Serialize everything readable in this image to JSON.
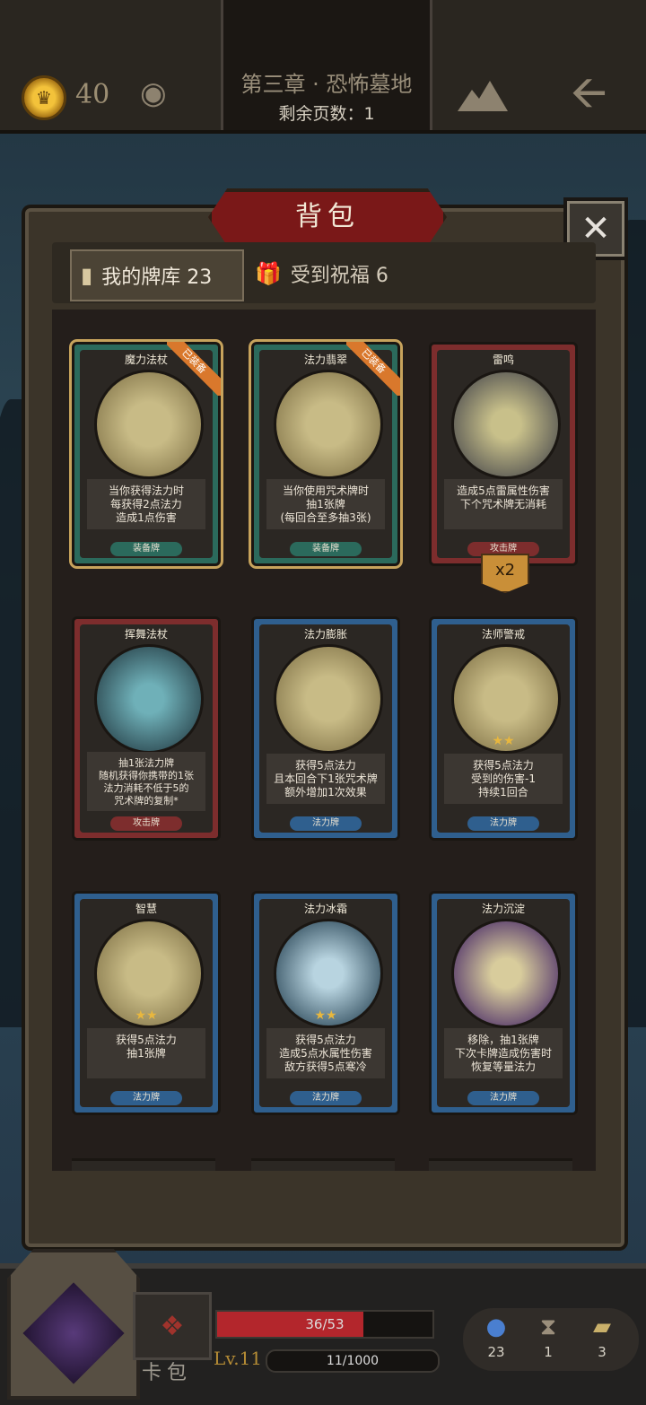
{
  "topbar": {
    "coins": "40",
    "chapter_title": "第三章 · 恐怖墓地",
    "pages_remaining": "剩余页数：1"
  },
  "panel": {
    "title": "背包",
    "close_label": "✕",
    "tabs": [
      {
        "label": "我的牌库 23",
        "icon": "card-icon"
      },
      {
        "label": "受到祝福 6",
        "icon": "gift-icon"
      }
    ]
  },
  "cards": [
    {
      "name": "魔力法杖",
      "desc": "当你获得法力时\n每获得2点法力\n造成1点伤害",
      "type": "装备牌",
      "equipped": true,
      "badge": "已装备",
      "color": "teal"
    },
    {
      "name": "法力翡翠",
      "desc": "当你使用咒术牌时\n抽1张牌\n(每回合至多抽3张)",
      "type": "装备牌",
      "equipped": true,
      "badge": "已装备",
      "color": "teal"
    },
    {
      "name": "雷鸣",
      "desc": "造成5点雷属性伤害\n下个咒术牌无消耗",
      "type": "攻击牌",
      "equipped": false,
      "count": "x2",
      "color": "red"
    },
    {
      "name": "挥舞法杖",
      "desc": "抽1张法力牌\n随机获得你携带的1张\n法力消耗不低于5的\n咒术牌的复制*",
      "type": "攻击牌",
      "equipped": false,
      "color": "red"
    },
    {
      "name": "法力膨胀",
      "desc": "获得5点法力\n且本回合下1张咒术牌\n额外增加1次效果",
      "type": "法力牌",
      "equipped": false,
      "color": "blue"
    },
    {
      "name": "法师警戒",
      "desc": "获得5点法力\n受到的伤害-1\n持续1回合",
      "type": "法力牌",
      "equipped": false,
      "stars": "★★",
      "color": "blue"
    },
    {
      "name": "智慧",
      "desc": "获得5点法力\n抽1张牌",
      "type": "法力牌",
      "equipped": false,
      "stars": "★★",
      "color": "blue"
    },
    {
      "name": "法力冰霜",
      "desc": "获得5点法力\n造成5点水属性伤害\n敌方获得5点寒冷",
      "type": "法力牌",
      "equipped": false,
      "stars": "★★",
      "color": "blue"
    },
    {
      "name": "法力沉淀",
      "desc": "移除，抽1张牌\n下次卡牌造成伤害时\n恢复等量法力",
      "type": "法力牌",
      "equipped": false,
      "color": "blue"
    }
  ],
  "hud": {
    "bag_label": "卡包",
    "hp_text": "36/53",
    "hp_fraction": 0.68,
    "level": "Lv.11",
    "xp_text": "11/1000",
    "stats": [
      {
        "icon": "potion-icon",
        "value": "23"
      },
      {
        "icon": "hourglass-icon",
        "value": "1"
      },
      {
        "icon": "cards-icon",
        "value": "3"
      }
    ]
  },
  "colors": {
    "accent": "#7a1818",
    "equip": "#2b6a5c",
    "attack": "#7d2d2d",
    "mana": "#2f5f8e",
    "gold": "#e6b44a"
  }
}
